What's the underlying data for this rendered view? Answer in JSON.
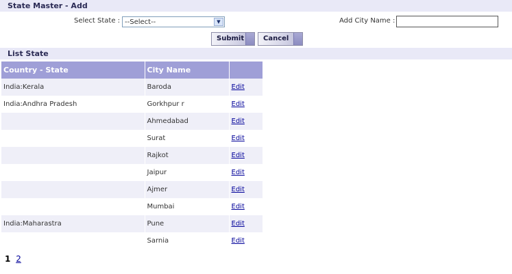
{
  "add_section": {
    "title": "State Master - Add",
    "select_state_label": "Select State :",
    "select_state_value": "--Select--",
    "add_city_label": "Add City Name :",
    "add_city_value": "",
    "submit_label": "Submit",
    "cancel_label": "Cancel"
  },
  "list_section": {
    "title": "List State",
    "columns": [
      "Country - State",
      "City Name",
      ""
    ],
    "rows": [
      {
        "state": "India:Kerala",
        "city": "Baroda",
        "action": "Edit"
      },
      {
        "state": "India:Andhra Pradesh",
        "city": "Gorkhpur r",
        "action": "Edit"
      },
      {
        "state": "",
        "city": "Ahmedabad",
        "action": "Edit"
      },
      {
        "state": "",
        "city": "Surat",
        "action": "Edit"
      },
      {
        "state": "",
        "city": "Rajkot",
        "action": "Edit"
      },
      {
        "state": "",
        "city": "Jaipur",
        "action": "Edit"
      },
      {
        "state": "",
        "city": "Ajmer",
        "action": "Edit"
      },
      {
        "state": "",
        "city": "Mumbai",
        "action": "Edit"
      },
      {
        "state": "India:Maharastra",
        "city": "Pune",
        "action": "Edit"
      },
      {
        "state": "",
        "city": "Sarnia",
        "action": "Edit"
      }
    ]
  },
  "pager": {
    "current_page": "1",
    "next_page": "2"
  },
  "colors": {
    "header_bg": "#e9e9f7",
    "grid_header_bg": "#9f9fd7",
    "alt_row_bg": "#efeff8",
    "link": "#000099"
  }
}
